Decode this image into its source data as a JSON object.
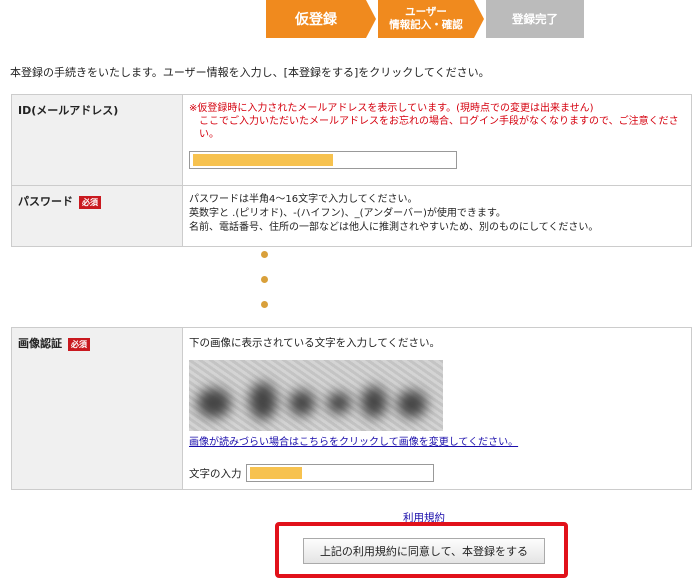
{
  "steps": {
    "step1": "仮登録",
    "step2_line1": "ユーザー",
    "step2_line2": "情報記入・確認",
    "step3": "登録完了"
  },
  "intro": "本登録の手続きをいたします。ユーザー情報を入力し、[本登録をする]をクリックしてください。",
  "id_row": {
    "label": "ID(メールアドレス)",
    "note_line1": "※仮登録時に入力されたメールアドレスを表示しています。(現時点での変更は出来ません)",
    "note_line2": "ここでご入力いただいたメールアドレスをお忘れの場合、ログイン手段がなくなりますので、ご注意ください。"
  },
  "password_row": {
    "label": "パスワード",
    "required": "必須",
    "line1": "パスワードは半角4～16文字で入力してください。",
    "line2": "英数字と .(ピリオド)、-(ハイフン)、_(アンダーバー)が使用できます。",
    "line3": "名前、電話番号、住所の一部などは他人に推測されやすいため、別のものにしてください。"
  },
  "captcha_row": {
    "label": "画像認証",
    "required": "必須",
    "instruction": "下の画像に表示されている文字を入力してください。",
    "refresh_link": "画像が読みづらい場合はこちらをクリックして画像を変更してください。",
    "input_label": "文字の入力"
  },
  "terms_link": "利用規約",
  "submit_label": "上記の利用規約に同意して、本登録をする",
  "colors": {
    "accent": "#f08a1e",
    "required": "#c9191f",
    "highlight": "#e1111a"
  }
}
